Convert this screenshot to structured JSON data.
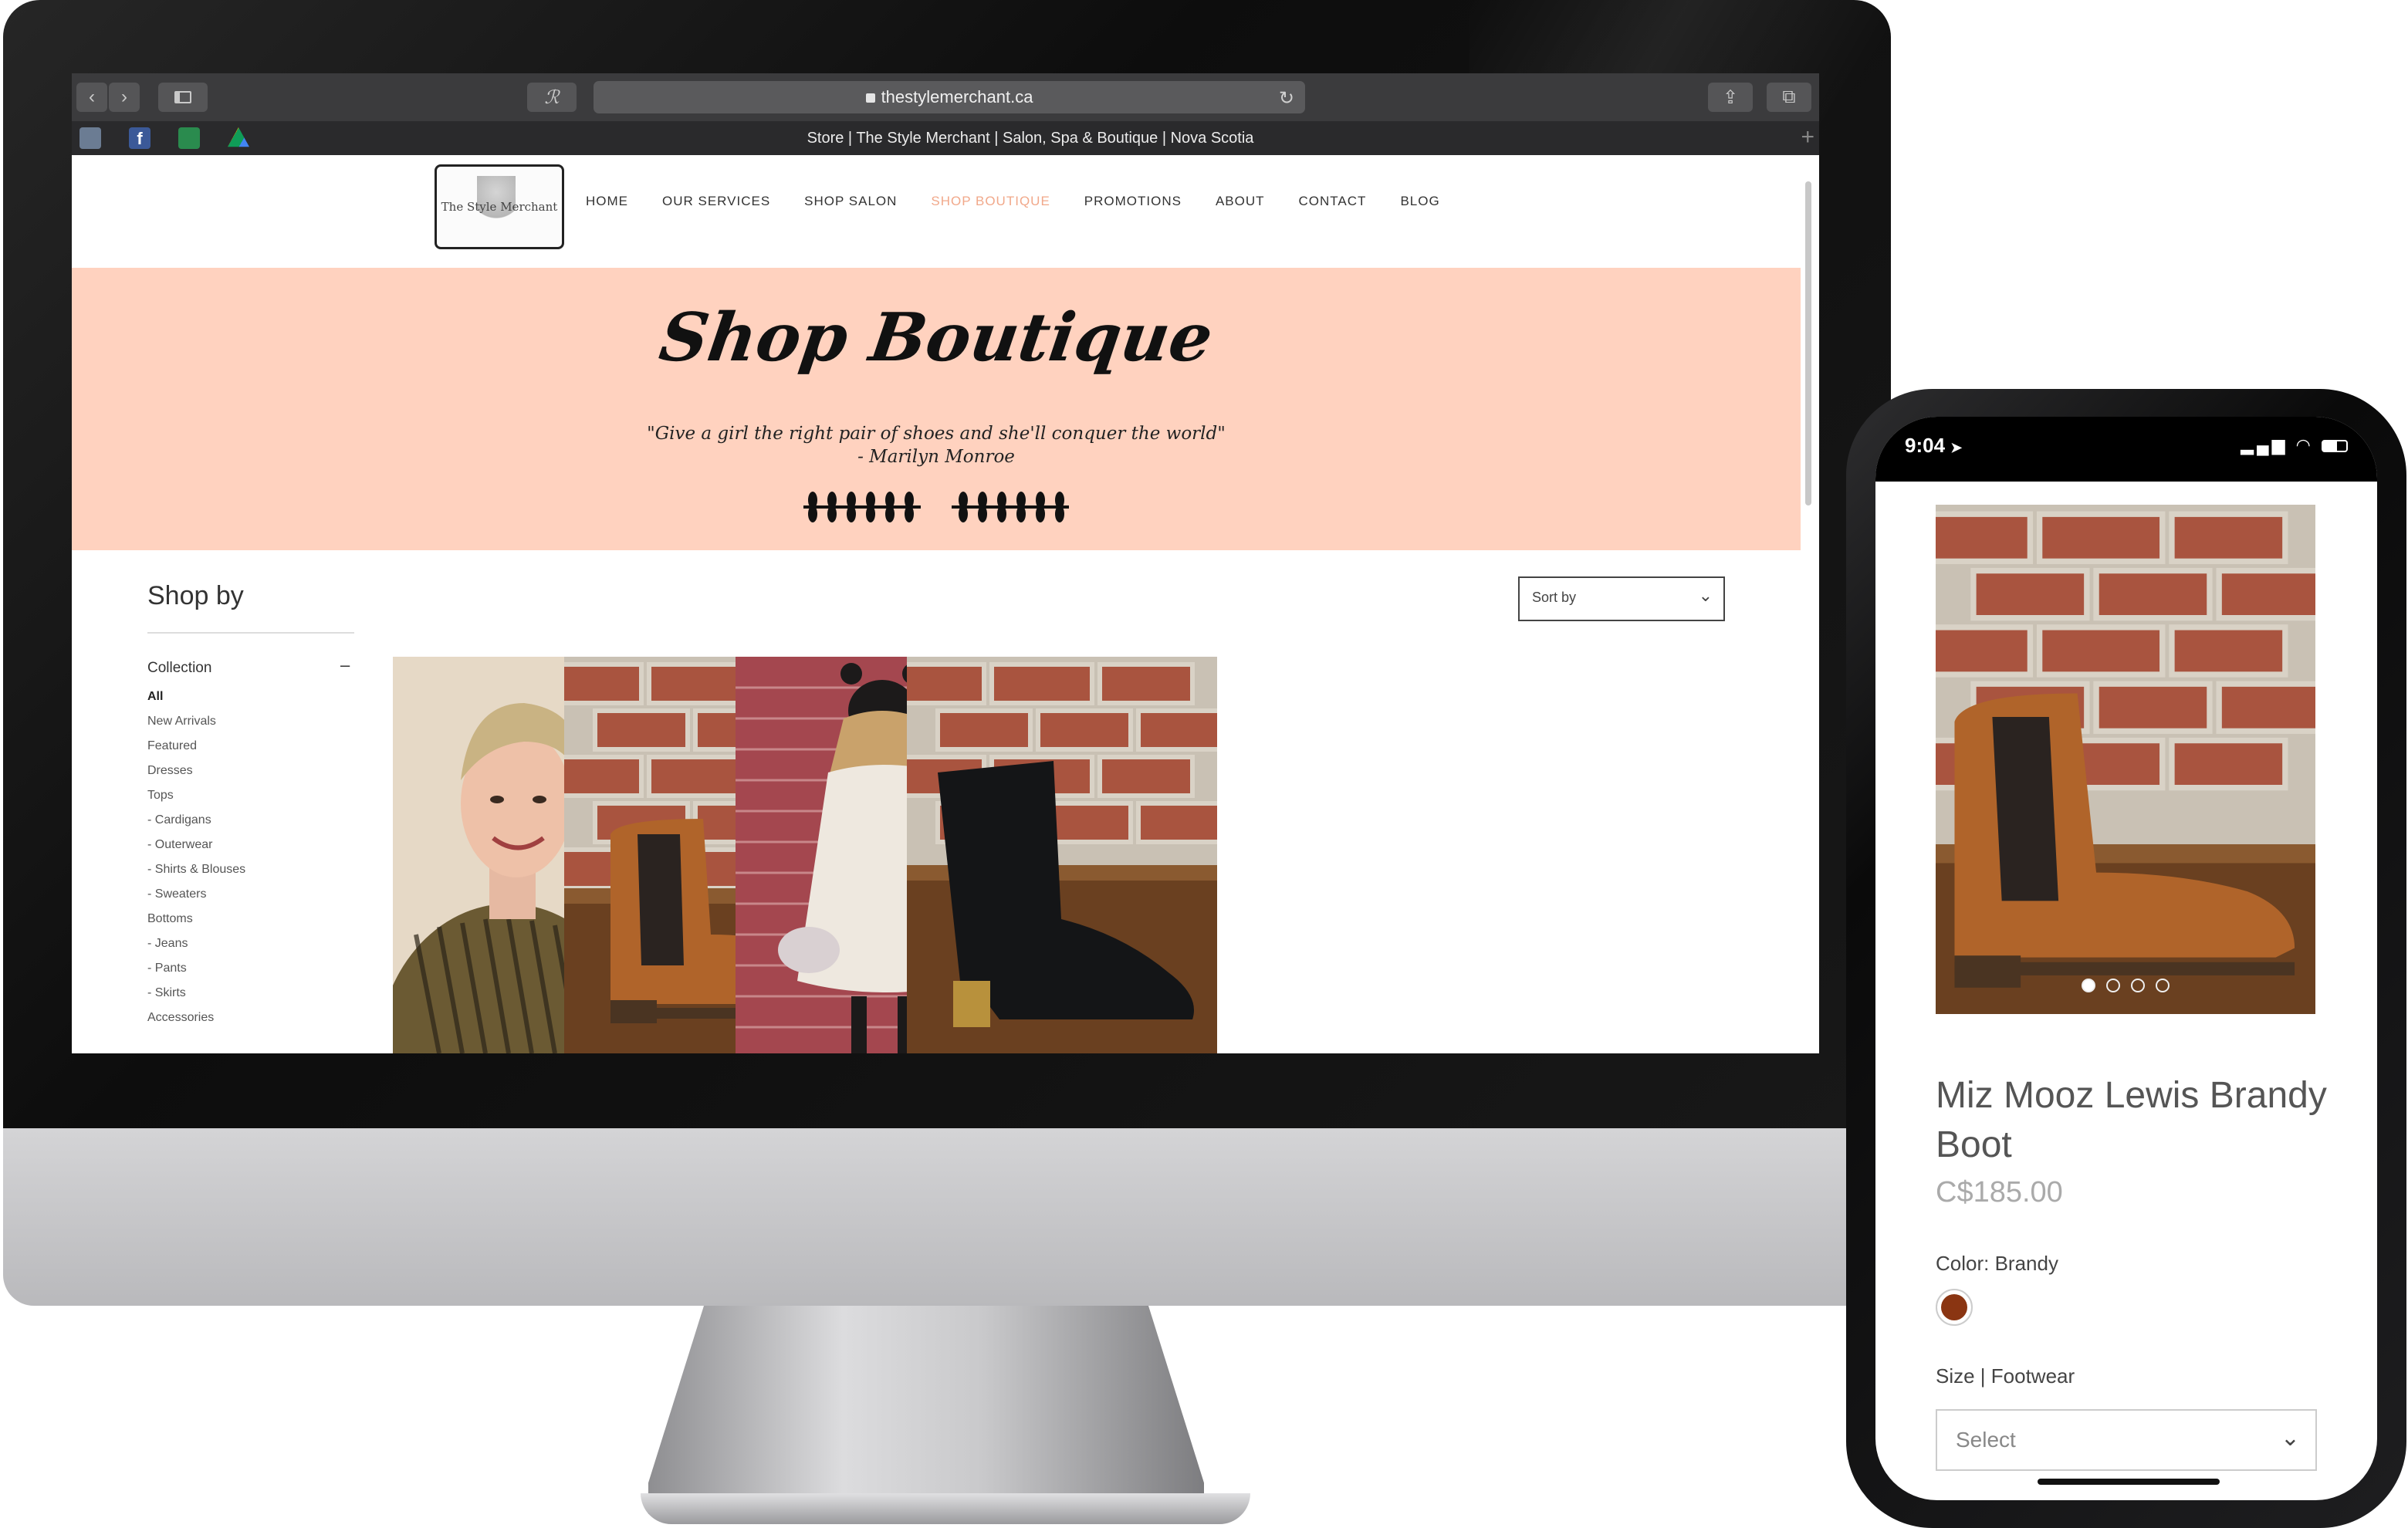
{
  "browser": {
    "url": "thestylemerchant.ca",
    "tab_title": "Store | The Style Merchant | Salon, Spa & Boutique | Nova Scotia"
  },
  "site": {
    "logo_text": "The Style Merchant",
    "nav": [
      "HOME",
      "OUR SERVICES",
      "SHOP SALON",
      "SHOP BOUTIQUE",
      "PROMOTIONS",
      "ABOUT",
      "CONTACT",
      "BLOG"
    ],
    "active_nav": "SHOP BOUTIQUE",
    "accent_color": "#f1a88a",
    "hero_bg_color": "#ffd2bf",
    "hero": {
      "title": "Shop Boutique",
      "quote": "\"Give a girl the right pair of shoes and she'll conquer the world\"",
      "quote_author": "- Marilyn Monroe"
    },
    "sidebar": {
      "title": "Shop by",
      "collection_label": "Collection",
      "collection_toggle": "–",
      "items": [
        "All",
        "New Arrivals",
        "Featured",
        "Dresses",
        "Tops",
        "- Cardigans",
        "- Outerwear",
        "- Shirts & Blouses",
        "- Sweaters",
        "Bottoms",
        "- Jeans",
        "- Pants",
        "- Skirts",
        "Accessories"
      ]
    },
    "sort_label": "Sort by",
    "products": [
      {
        "name": "portrait"
      },
      {
        "name": "brandy-boot"
      },
      {
        "name": "white-cape"
      },
      {
        "name": "black-boot"
      }
    ]
  },
  "phone": {
    "time": "9:04",
    "product_title": "Miz Mooz Lewis Brandy Boot",
    "price": "C$185.00",
    "color_label": "Color: Brandy",
    "swatch_color": "#8a3512",
    "size_label": "Size | Footwear",
    "select_placeholder": "Select",
    "image_count": 4,
    "active_image": 1
  }
}
